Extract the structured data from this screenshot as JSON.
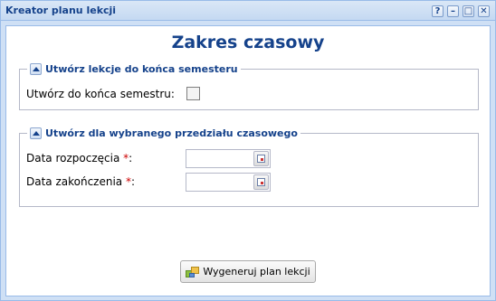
{
  "window": {
    "title": "Kreator planu lekcji",
    "tools": [
      "?",
      "–",
      "□",
      "✕"
    ]
  },
  "heading": "Zakres czasowy",
  "section1": {
    "legend": "Utwórz lekcje do końca semesteru",
    "checkbox_label": "Utwórz do końca semestru:",
    "checked": false
  },
  "section2": {
    "legend": "Utwórz dla wybranego przedziału czasowego",
    "start_label": "Data rozpoczęcia",
    "end_label": "Data zakończenia",
    "required_mark": "*",
    "colon": ":",
    "start_value": "",
    "end_value": ""
  },
  "footer": {
    "generate_label": "Wygeneruj plan lekcji"
  },
  "icons": {
    "help": "help-icon",
    "minimize": "minimize-icon",
    "maximize": "maximize-icon",
    "close": "close-icon",
    "collapse": "collapse-up-icon",
    "calendar": "calendar-icon",
    "generate": "generate-icon"
  }
}
